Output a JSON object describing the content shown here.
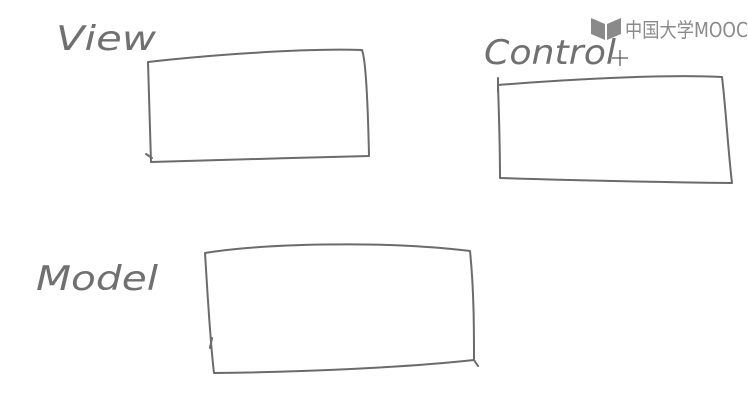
{
  "labels": {
    "view": "View",
    "control": "Control",
    "model": "Model"
  },
  "watermark": {
    "text": "中国大学MOOC",
    "icon": "mooc-book-logo-icon"
  },
  "colors": {
    "ink": "#6b6b6b",
    "watermark": "#8a8a8a",
    "background": "#ffffff"
  }
}
